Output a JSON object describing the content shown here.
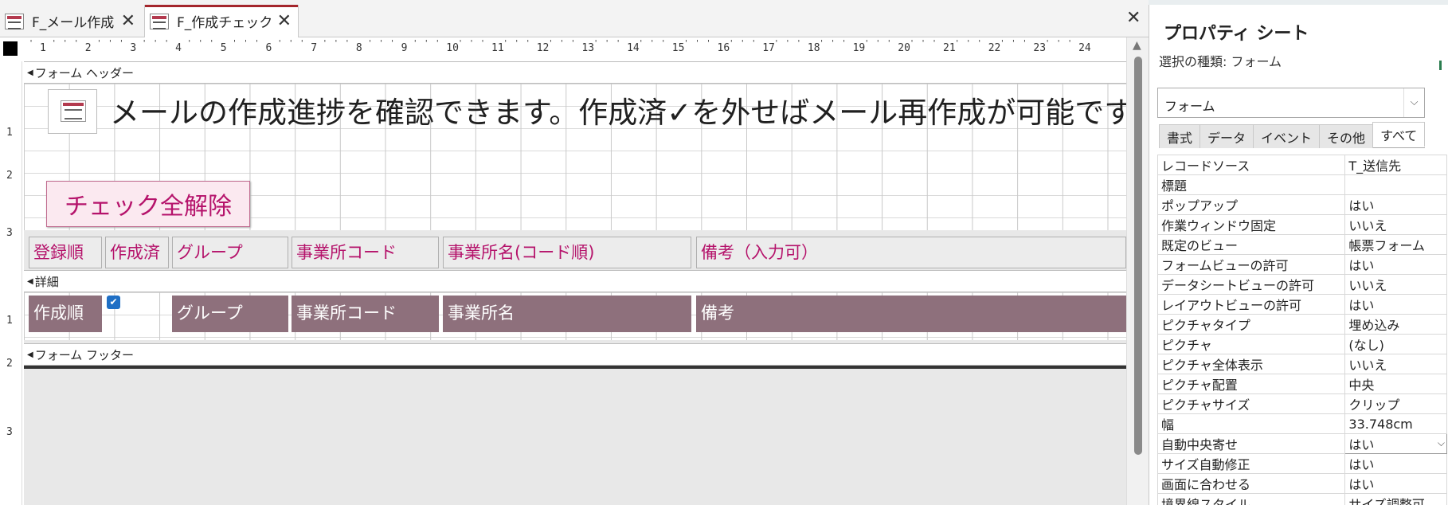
{
  "tabs": [
    {
      "label": "F_メール作成",
      "active": false
    },
    {
      "label": "F_作成チェック",
      "active": true
    }
  ],
  "ruler": {
    "h_marks": [
      "1",
      "2",
      "3",
      "4",
      "5",
      "6",
      "7",
      "8",
      "9",
      "10",
      "11",
      "12",
      "13",
      "14",
      "15",
      "16",
      "17",
      "18",
      "19",
      "20",
      "21",
      "22",
      "23",
      "24"
    ],
    "v_marks": [
      "1",
      "2",
      "3",
      "1",
      "2",
      "3"
    ]
  },
  "bands": {
    "header": "フォーム ヘッダー",
    "detail": "詳細",
    "footer": "フォーム フッター"
  },
  "form_header": {
    "title": "メールの作成進捗を確認できます。作成済✓を外せばメール再作成が可能です。",
    "clear_button": "チェック全解除",
    "column_labels": [
      "登録順",
      "作成済",
      "グループ",
      "事業所コード",
      "事業所名(コード順)",
      "備考（入力可）"
    ]
  },
  "detail_controls": {
    "order": "作成順",
    "checkbox_checked": true,
    "fields": [
      "グループ",
      "事業所コード",
      "事業所名",
      "備考"
    ]
  },
  "property_sheet": {
    "title": "プロパティ シート",
    "selection_type": "選択の種類: フォーム",
    "selected_object": "フォーム",
    "tabs": [
      "書式",
      "データ",
      "イベント",
      "その他",
      "すべて"
    ],
    "active_tab": "すべて",
    "properties": [
      {
        "name": "レコードソース",
        "value": "T_送信先"
      },
      {
        "name": "標題",
        "value": ""
      },
      {
        "name": "ポップアップ",
        "value": "はい"
      },
      {
        "name": "作業ウィンドウ固定",
        "value": "いいえ"
      },
      {
        "name": "既定のビュー",
        "value": "帳票フォーム"
      },
      {
        "name": "フォームビューの許可",
        "value": "はい"
      },
      {
        "name": "データシートビューの許可",
        "value": "いいえ"
      },
      {
        "name": "レイアウトビューの許可",
        "value": "はい"
      },
      {
        "name": "ピクチャタイプ",
        "value": "埋め込み"
      },
      {
        "name": "ピクチャ",
        "value": "(なし)"
      },
      {
        "name": "ピクチャ全体表示",
        "value": "いいえ"
      },
      {
        "name": "ピクチャ配置",
        "value": "中央"
      },
      {
        "name": "ピクチャサイズ",
        "value": "クリップ"
      },
      {
        "name": "幅",
        "value": "33.748cm"
      },
      {
        "name": "自動中央寄せ",
        "value": "はい"
      },
      {
        "name": "サイズ自動修正",
        "value": "はい"
      },
      {
        "name": "画面に合わせる",
        "value": "はい"
      },
      {
        "name": "境界線スタイル",
        "value": "サイズ調整可"
      }
    ]
  },
  "colors": {
    "accent_tab": "#a4262c",
    "label_text": "#b5136b",
    "detail_fill": "#8e707c"
  }
}
